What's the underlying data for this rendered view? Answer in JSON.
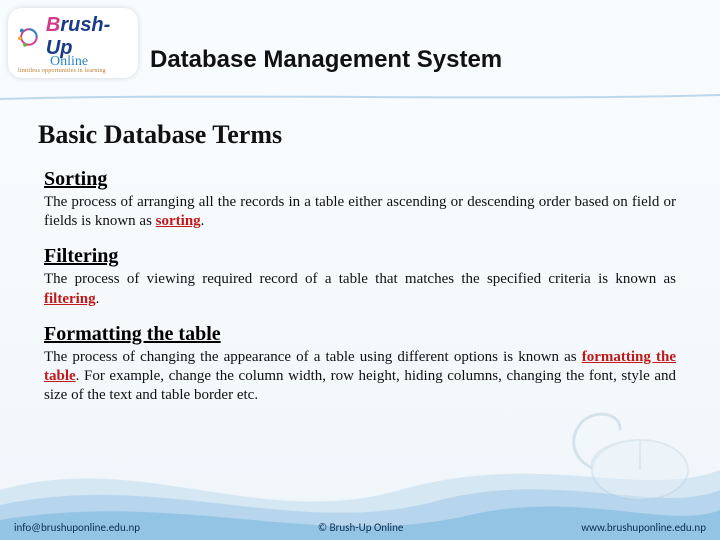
{
  "logo": {
    "brand_prefix": "B",
    "brand_rest": "rush-Up",
    "online": "Online",
    "tagline": "limitless opportunities in learning"
  },
  "header": {
    "title": "Database Management System"
  },
  "subtitle": "Basic Database Terms",
  "terms": [
    {
      "heading": "Sorting",
      "body_pre": "The process of arranging all the records in a table either ascending or descending order based on field or fields is known as ",
      "keyword": "sorting",
      "body_post": "."
    },
    {
      "heading": "Filtering",
      "body_pre": "The process of viewing required record of a table that matches the specified criteria is known as ",
      "keyword": "filtering",
      "body_post": "."
    },
    {
      "heading": "Formatting the table",
      "body_pre": "The process of changing the appearance of a table using different options is known as ",
      "keyword": "formatting the table",
      "body_post": ". For example, change the column width, row height, hiding columns, changing the font, style and size of the text and table border etc."
    }
  ],
  "footer": {
    "email": "info@brushuponline.edu.np",
    "copyright": "© Brush-Up Online",
    "site": "www.brushuponline.edu.np"
  }
}
